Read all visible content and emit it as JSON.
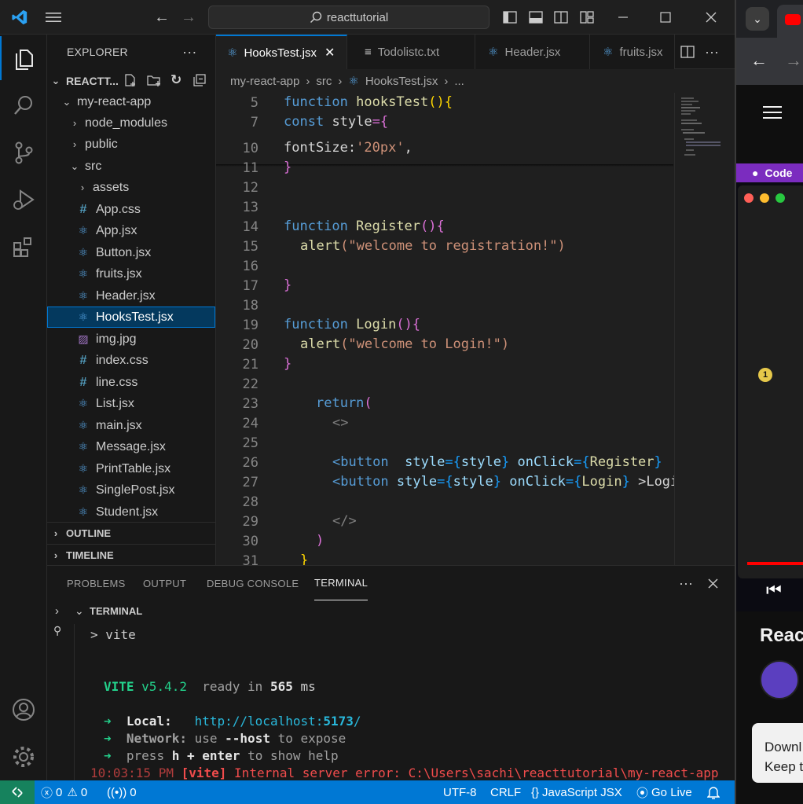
{
  "titlebar": {
    "search_text": "reacttutorial"
  },
  "sidebar": {
    "header": "EXPLORER",
    "workspace": "REACTT...",
    "tree": [
      {
        "label": "my-react-app"
      },
      {
        "label": "node_modules"
      },
      {
        "label": "public"
      },
      {
        "label": "src"
      },
      {
        "label": "assets"
      },
      {
        "label": "App.css"
      },
      {
        "label": "App.jsx"
      },
      {
        "label": "Button.jsx"
      },
      {
        "label": "fruits.jsx"
      },
      {
        "label": "Header.jsx"
      },
      {
        "label": "HooksTest.jsx"
      },
      {
        "label": "img.jpg"
      },
      {
        "label": "index.css"
      },
      {
        "label": "line.css"
      },
      {
        "label": "List.jsx"
      },
      {
        "label": "main.jsx"
      },
      {
        "label": "Message.jsx"
      },
      {
        "label": "PrintTable.jsx"
      },
      {
        "label": "SinglePost.jsx"
      },
      {
        "label": "Student.jsx"
      }
    ],
    "outline": "OUTLINE",
    "timeline": "TIMELINE"
  },
  "tabs": [
    "HooksTest.jsx",
    "Todolistc.txt",
    "Header.jsx",
    "fruits.jsx"
  ],
  "breadcrumb": [
    "my-react-app",
    "src",
    "HooksTest.jsx",
    "..."
  ],
  "line_numbers": [
    "5",
    "7",
    "10",
    "11",
    "12",
    "13",
    "14",
    "15",
    "16",
    "17",
    "18",
    "19",
    "20",
    "21",
    "22",
    "23",
    "24",
    "25",
    "26",
    "27",
    "28",
    "29",
    "30",
    "31"
  ],
  "code": {
    "l5": [
      "function",
      "hooksTest",
      "(){"
    ],
    "l7": [
      "const",
      "style",
      "={"
    ],
    "l10": [
      "fontSize",
      ":",
      "'20px'",
      ","
    ],
    "l11": "}",
    "l14": [
      "function",
      "Register",
      "(){"
    ],
    "l15": [
      "alert",
      "(\"welcome to registration!\")"
    ],
    "l17": "}",
    "l19": [
      "function",
      "Login",
      "(){"
    ],
    "l20": [
      "alert",
      "(\"welcome to Login!\")"
    ],
    "l21": "}",
    "l23": [
      "return",
      "("
    ],
    "l24": "<>",
    "l26": [
      "<button",
      "style",
      "={",
      "style",
      "}",
      "onClick",
      "={",
      "Register",
      "}"
    ],
    "l27": [
      "<button",
      "style",
      "={",
      "style",
      "}",
      "onClick",
      "={",
      "Login",
      "}",
      ">Logi"
    ],
    "l29": "</>",
    "l30": ")",
    "l31": "}"
  },
  "panel": {
    "tabs": [
      "PROBLEMS",
      "OUTPUT",
      "DEBUG CONSOLE",
      "TERMINAL"
    ],
    "terminal_label": "TERMINAL",
    "lines": {
      "prompt": "> vite",
      "vite": "VITE",
      "version": "v5.4.2",
      "ready": "ready in",
      "ms_value": "565",
      "ms": "ms",
      "arrow": "➜",
      "local_label": "Local:",
      "local_url_pre": "http://localhost:",
      "local_port": "5173",
      "local_url_post": "/",
      "network_label": "Network:",
      "network_text_1": "use",
      "network_host": "--host",
      "network_text_2": "to expose",
      "press": "press",
      "press_h": "h + enter",
      "press_rest": "to show help",
      "error_time": "10:03:15 PM",
      "error_tag": "[vite]",
      "error_text": "Internal server error: C:\\Users\\sachi\\reacttutorial\\my-react-app"
    }
  },
  "statusbar": {
    "errors": "0",
    "warnings": "0",
    "ports": "0",
    "encoding": "UTF-8",
    "eol": "CRLF",
    "language": "JavaScript JSX",
    "golive": "Go Live"
  },
  "browser": {
    "banner": "Code",
    "title": "Reac",
    "badge": "1",
    "toast_line1": "Downl",
    "toast_line2": "Keep t"
  },
  "colors": {
    "accent": "#0078d4",
    "statusbar": "#0078d4",
    "remote": "#16825d"
  }
}
